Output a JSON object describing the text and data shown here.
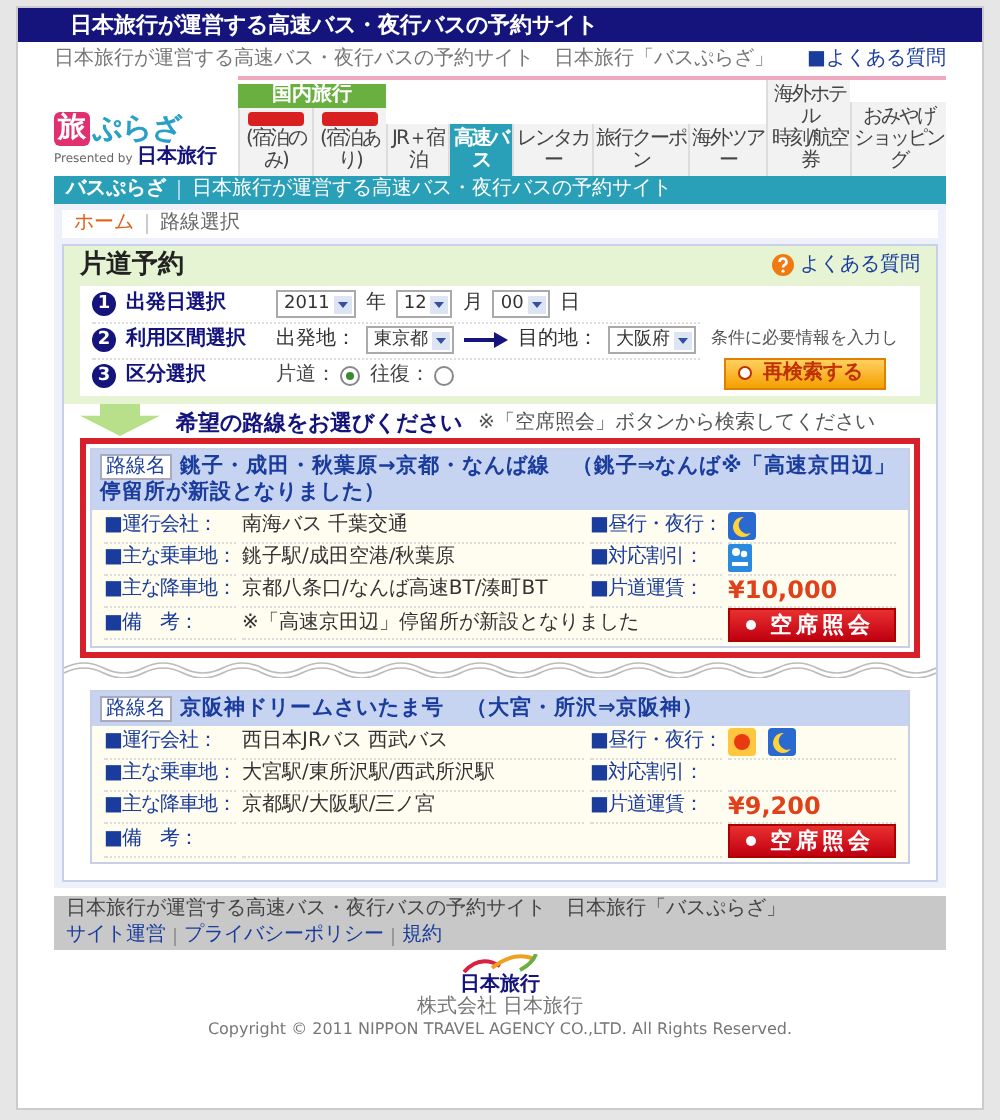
{
  "header": {
    "title": "日本旅行が運営する高速バス・夜行バスの予約サイト",
    "tagline": "日本旅行が運営する高速バス・夜行バスの予約サイト　日本旅行「バスぷらざ」",
    "faq_link": "■よくある質問"
  },
  "logo": {
    "mark": "旅",
    "name": "ぷらざ",
    "presented": "Presented by",
    "company": "日本旅行"
  },
  "nav": {
    "group_label": "国内旅行",
    "tabs": [
      {
        "lines": [
          "(宿泊のみ)"
        ],
        "kind": "promo",
        "selected": false
      },
      {
        "lines": [
          "(宿泊あり)"
        ],
        "kind": "promo",
        "selected": false
      },
      {
        "lines": [
          "JR＋宿泊"
        ],
        "kind": "tab",
        "selected": false
      },
      {
        "lines": [
          "高速バス"
        ],
        "kind": "tab",
        "selected": true
      },
      {
        "lines": [
          "レンタカー"
        ],
        "kind": "tab",
        "selected": false
      },
      {
        "lines": [
          "旅行クーポン"
        ],
        "kind": "tab",
        "selected": false
      },
      {
        "lines": [
          "海外ツアー"
        ],
        "kind": "tab",
        "selected": false
      },
      {
        "lines": [
          "海外ホテル",
          "時刻/航空券"
        ],
        "kind": "tab",
        "selected": false
      },
      {
        "lines": [
          "おみやげ",
          "ショッピング"
        ],
        "kind": "tab",
        "selected": false
      }
    ]
  },
  "subbar": {
    "title": "バスぷらざ",
    "text": "日本旅行が運営する高速バス・夜行バスの予約サイト"
  },
  "breadcrumb": [
    {
      "label": "ホーム",
      "kind": "link"
    },
    {
      "label": "路線選択",
      "kind": "current"
    }
  ],
  "search": {
    "title": "片道予約",
    "help": "よくある質問",
    "date": {
      "step": "1",
      "label": "出発日選択",
      "parts": [
        {
          "value": "2011",
          "unit": "年"
        },
        {
          "value": "12",
          "unit": "月"
        },
        {
          "value": "00",
          "unit": "日"
        }
      ]
    },
    "route": {
      "step": "2",
      "label": "利用区間選択",
      "from_label": "出発地：",
      "from": "東京都",
      "to_label": "目的地：",
      "to": "大阪府"
    },
    "trip": {
      "step": "3",
      "label": "区分選択",
      "options": [
        {
          "label": "片道：",
          "selected": true
        },
        {
          "label": "往復：",
          "selected": false
        }
      ]
    },
    "note": "条件に必要情報を入力し",
    "button": "再検索する"
  },
  "prompt": {
    "title": "希望の路線をお選びください",
    "note": "※「空席照会」ボタンから検索してください"
  },
  "routes": [
    {
      "highlighted": true,
      "tag": "路線名",
      "name": "銚子・成田・秋葉原→京都・なんば線　（銚子⇒なんば※「高速京田辺」停留所が新設となりました）",
      "operator": {
        "label": "■運行会社：",
        "value": "南海バス 千葉交通"
      },
      "service": {
        "label": "■昼行・夜行：",
        "icons": [
          {
            "kind": "night"
          }
        ]
      },
      "boarding": {
        "label": "■主な乗車地：",
        "value": "銚子駅/成田空港/秋葉原"
      },
      "discount": {
        "label": "■対応割引：",
        "available": true
      },
      "alighting": {
        "label": "■主な降車地：",
        "value": "京都八条口/なんば高速BT/湊町BT"
      },
      "fare": {
        "label": "■片道運賃：",
        "value": "¥10,000"
      },
      "remarks": {
        "label": "■備　考：",
        "value": "※「高速京田辺」停留所が新設となりました"
      },
      "button": "空席照会"
    },
    {
      "highlighted": false,
      "tag": "路線名",
      "name": "京阪神ドリームさいたま号　（大宮・所沢⇒京阪神）",
      "operator": {
        "label": "■運行会社：",
        "value": "西日本JRバス 西武バス"
      },
      "service": {
        "label": "■昼行・夜行：",
        "icons": [
          {
            "kind": "day"
          },
          {
            "kind": "night"
          }
        ]
      },
      "boarding": {
        "label": "■主な乗車地：",
        "value": "大宮駅/東所沢駅/西武所沢駅"
      },
      "discount": {
        "label": "■対応割引：",
        "available": false
      },
      "alighting": {
        "label": "■主な降車地：",
        "value": "京都駅/大阪駅/三ノ宮"
      },
      "fare": {
        "label": "■片道運賃：",
        "value": "¥9,200"
      },
      "remarks": {
        "label": "■備　考："
      },
      "button": "空席照会"
    }
  ],
  "footer": {
    "text": "日本旅行が運営する高速バス・夜行バスの予約サイト　日本旅行「バスぷらざ」",
    "links": [
      "サイト運営",
      "プライバシーポリシー",
      "規約"
    ],
    "logo_text": "日本旅行",
    "company": "株式会社 日本旅行",
    "copyright": "Copyright © 2011 NIPPON TRAVEL AGENCY CO.,LTD. All Rights Reserved."
  }
}
